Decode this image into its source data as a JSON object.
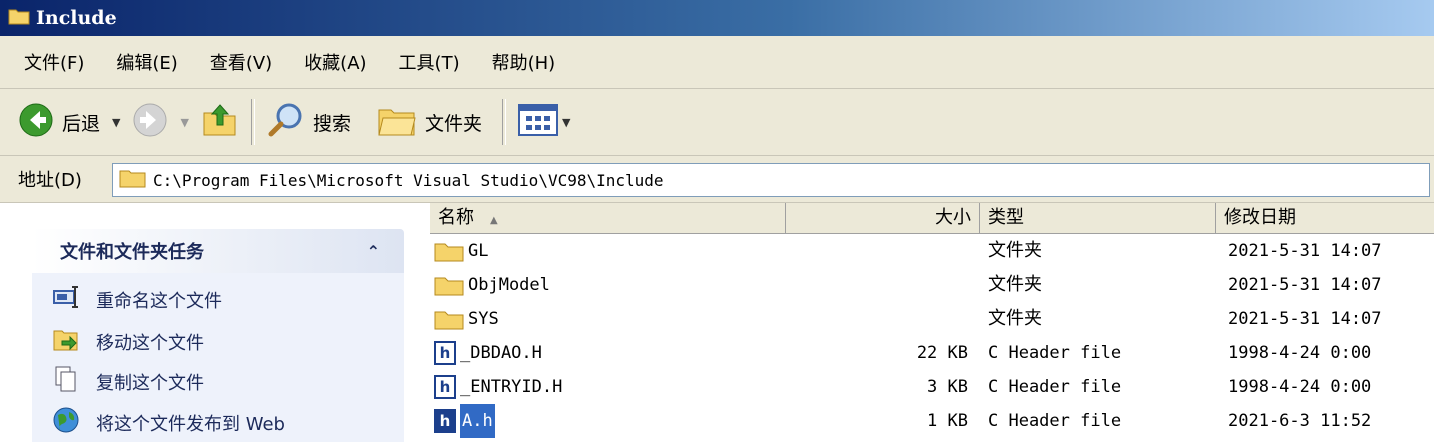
{
  "window": {
    "title": "Include"
  },
  "menu": [
    "文件(F)",
    "编辑(E)",
    "查看(V)",
    "收藏(A)",
    "工具(T)",
    "帮助(H)"
  ],
  "toolbar": {
    "back": "后退",
    "search": "搜索",
    "folders": "文件夹"
  },
  "address": {
    "label": "地址(D)",
    "path": "C:\\Program Files\\Microsoft Visual Studio\\VC98\\Include"
  },
  "tasks": {
    "header": "文件和文件夹任务",
    "items": [
      "重命名这个文件",
      "移动这个文件",
      "复制这个文件",
      "将这个文件发布到 Web"
    ]
  },
  "columns": {
    "name": "名称",
    "size": "大小",
    "type": "类型",
    "modified": "修改日期"
  },
  "files": [
    {
      "name": "GL",
      "size": "",
      "type": "文件夹",
      "modified": "2021-5-31 14:07",
      "kind": "folder",
      "selected": false
    },
    {
      "name": "ObjModel",
      "size": "",
      "type": "文件夹",
      "modified": "2021-5-31 14:07",
      "kind": "folder",
      "selected": false
    },
    {
      "name": "SYS",
      "size": "",
      "type": "文件夹",
      "modified": "2021-5-31 14:07",
      "kind": "folder",
      "selected": false
    },
    {
      "name": "_DBDAO.H",
      "size": "22 KB",
      "type": "C Header file",
      "modified": "1998-4-24 0:00",
      "kind": "header",
      "selected": false
    },
    {
      "name": "_ENTRYID.H",
      "size": "3 KB",
      "type": "C Header file",
      "modified": "1998-4-24 0:00",
      "kind": "header",
      "selected": false
    },
    {
      "name": "A.h",
      "size": "1 KB",
      "type": "C Header file",
      "modified": "2021-6-3 11:52",
      "kind": "header",
      "selected": true
    }
  ]
}
